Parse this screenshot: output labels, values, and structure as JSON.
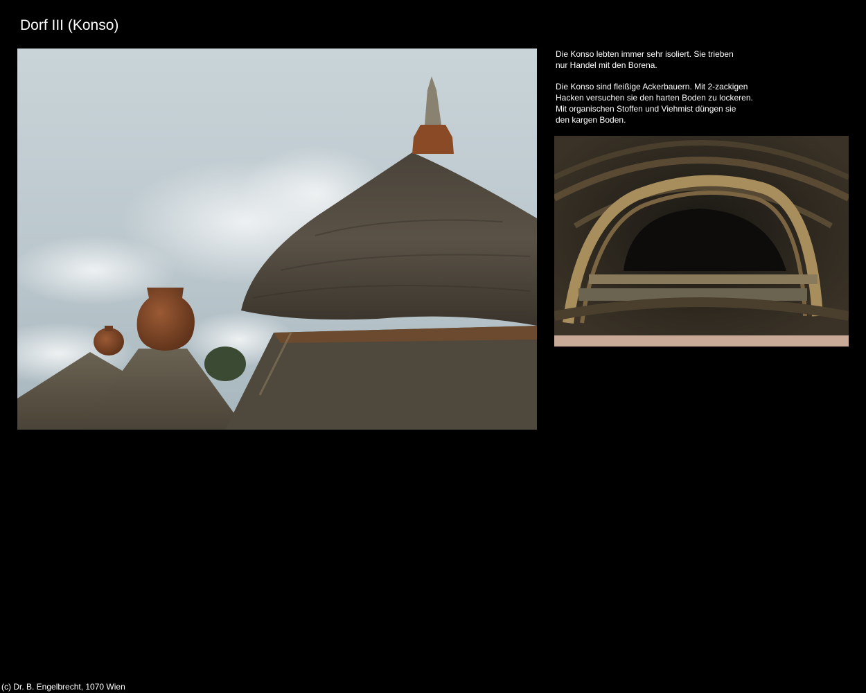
{
  "page": {
    "title": "Dorf III (Konso)"
  },
  "description": {
    "paragraph_1_lines": [
      "Die Konso lebten immer sehr isoliert. Sie trieben",
      "nur Handel mit den Borena."
    ],
    "paragraph_2_lines": [
      "Die Konso sind fleißige Ackerbauern. Mit 2-zackigen",
      "Hacken versuchen sie den harten Boden zu lockeren.",
      "Mit organischen Stoffen und Viehmist düngen sie",
      "den kargen Boden."
    ]
  },
  "footer": {
    "copyright": "(c) Dr. B. Engelbrecht, 1070 Wien"
  },
  "colors": {
    "background": "#000000",
    "text": "#ffffff"
  }
}
